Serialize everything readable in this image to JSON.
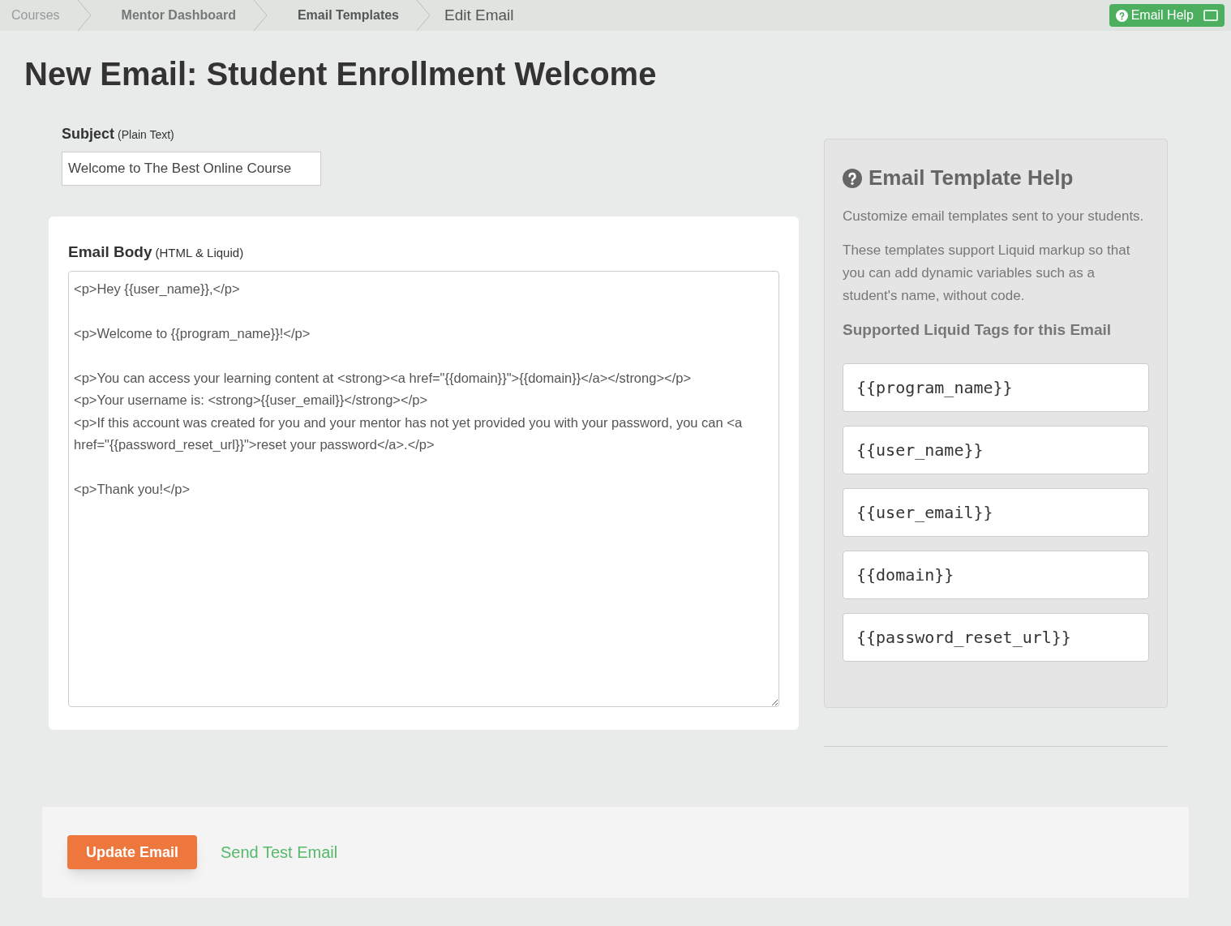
{
  "breadcrumbs": [
    {
      "label": "Courses",
      "current": false
    },
    {
      "label": "Mentor Dashboard",
      "current": false
    },
    {
      "label": "Email Templates",
      "current": false
    },
    {
      "label": "Edit Email",
      "current": true
    }
  ],
  "help_button": {
    "label": "Email Help"
  },
  "title": "New Email: Student Enrollment Welcome",
  "subject": {
    "label": "Subject",
    "hint": "(Plain Text)",
    "value": "Welcome to The Best Online Course"
  },
  "body": {
    "label": "Email Body",
    "hint": "(HTML & Liquid)",
    "value": "<p>Hey {{user_name}},</p>\n\n<p>Welcome to {{program_name}}!</p>\n\n<p>You can access your learning content at <strong><a href=\"{{domain}}\">{{domain}}</a></strong></p>\n<p>Your username is: <strong>{{user_email}}</strong></p>\n<p>If this account was created for you and your mentor has not yet provided you with your password, you can <a href=\"{{password_reset_url}}\">reset your password</a>.</p>\n\n<p>Thank you!</p>"
  },
  "help": {
    "title": "Email Template Help",
    "paragraphs": [
      "Customize email templates sent to your students.",
      "These templates support Liquid markup so that you can add dynamic variables such as a student's name, without code."
    ],
    "tags_heading": "Supported Liquid Tags for this Email",
    "tags": [
      "{{program_name}}",
      "{{user_name}}",
      "{{user_email}}",
      "{{domain}}",
      "{{password_reset_url}}"
    ]
  },
  "actions": {
    "primary": "Update Email",
    "secondary": "Send Test Email"
  }
}
